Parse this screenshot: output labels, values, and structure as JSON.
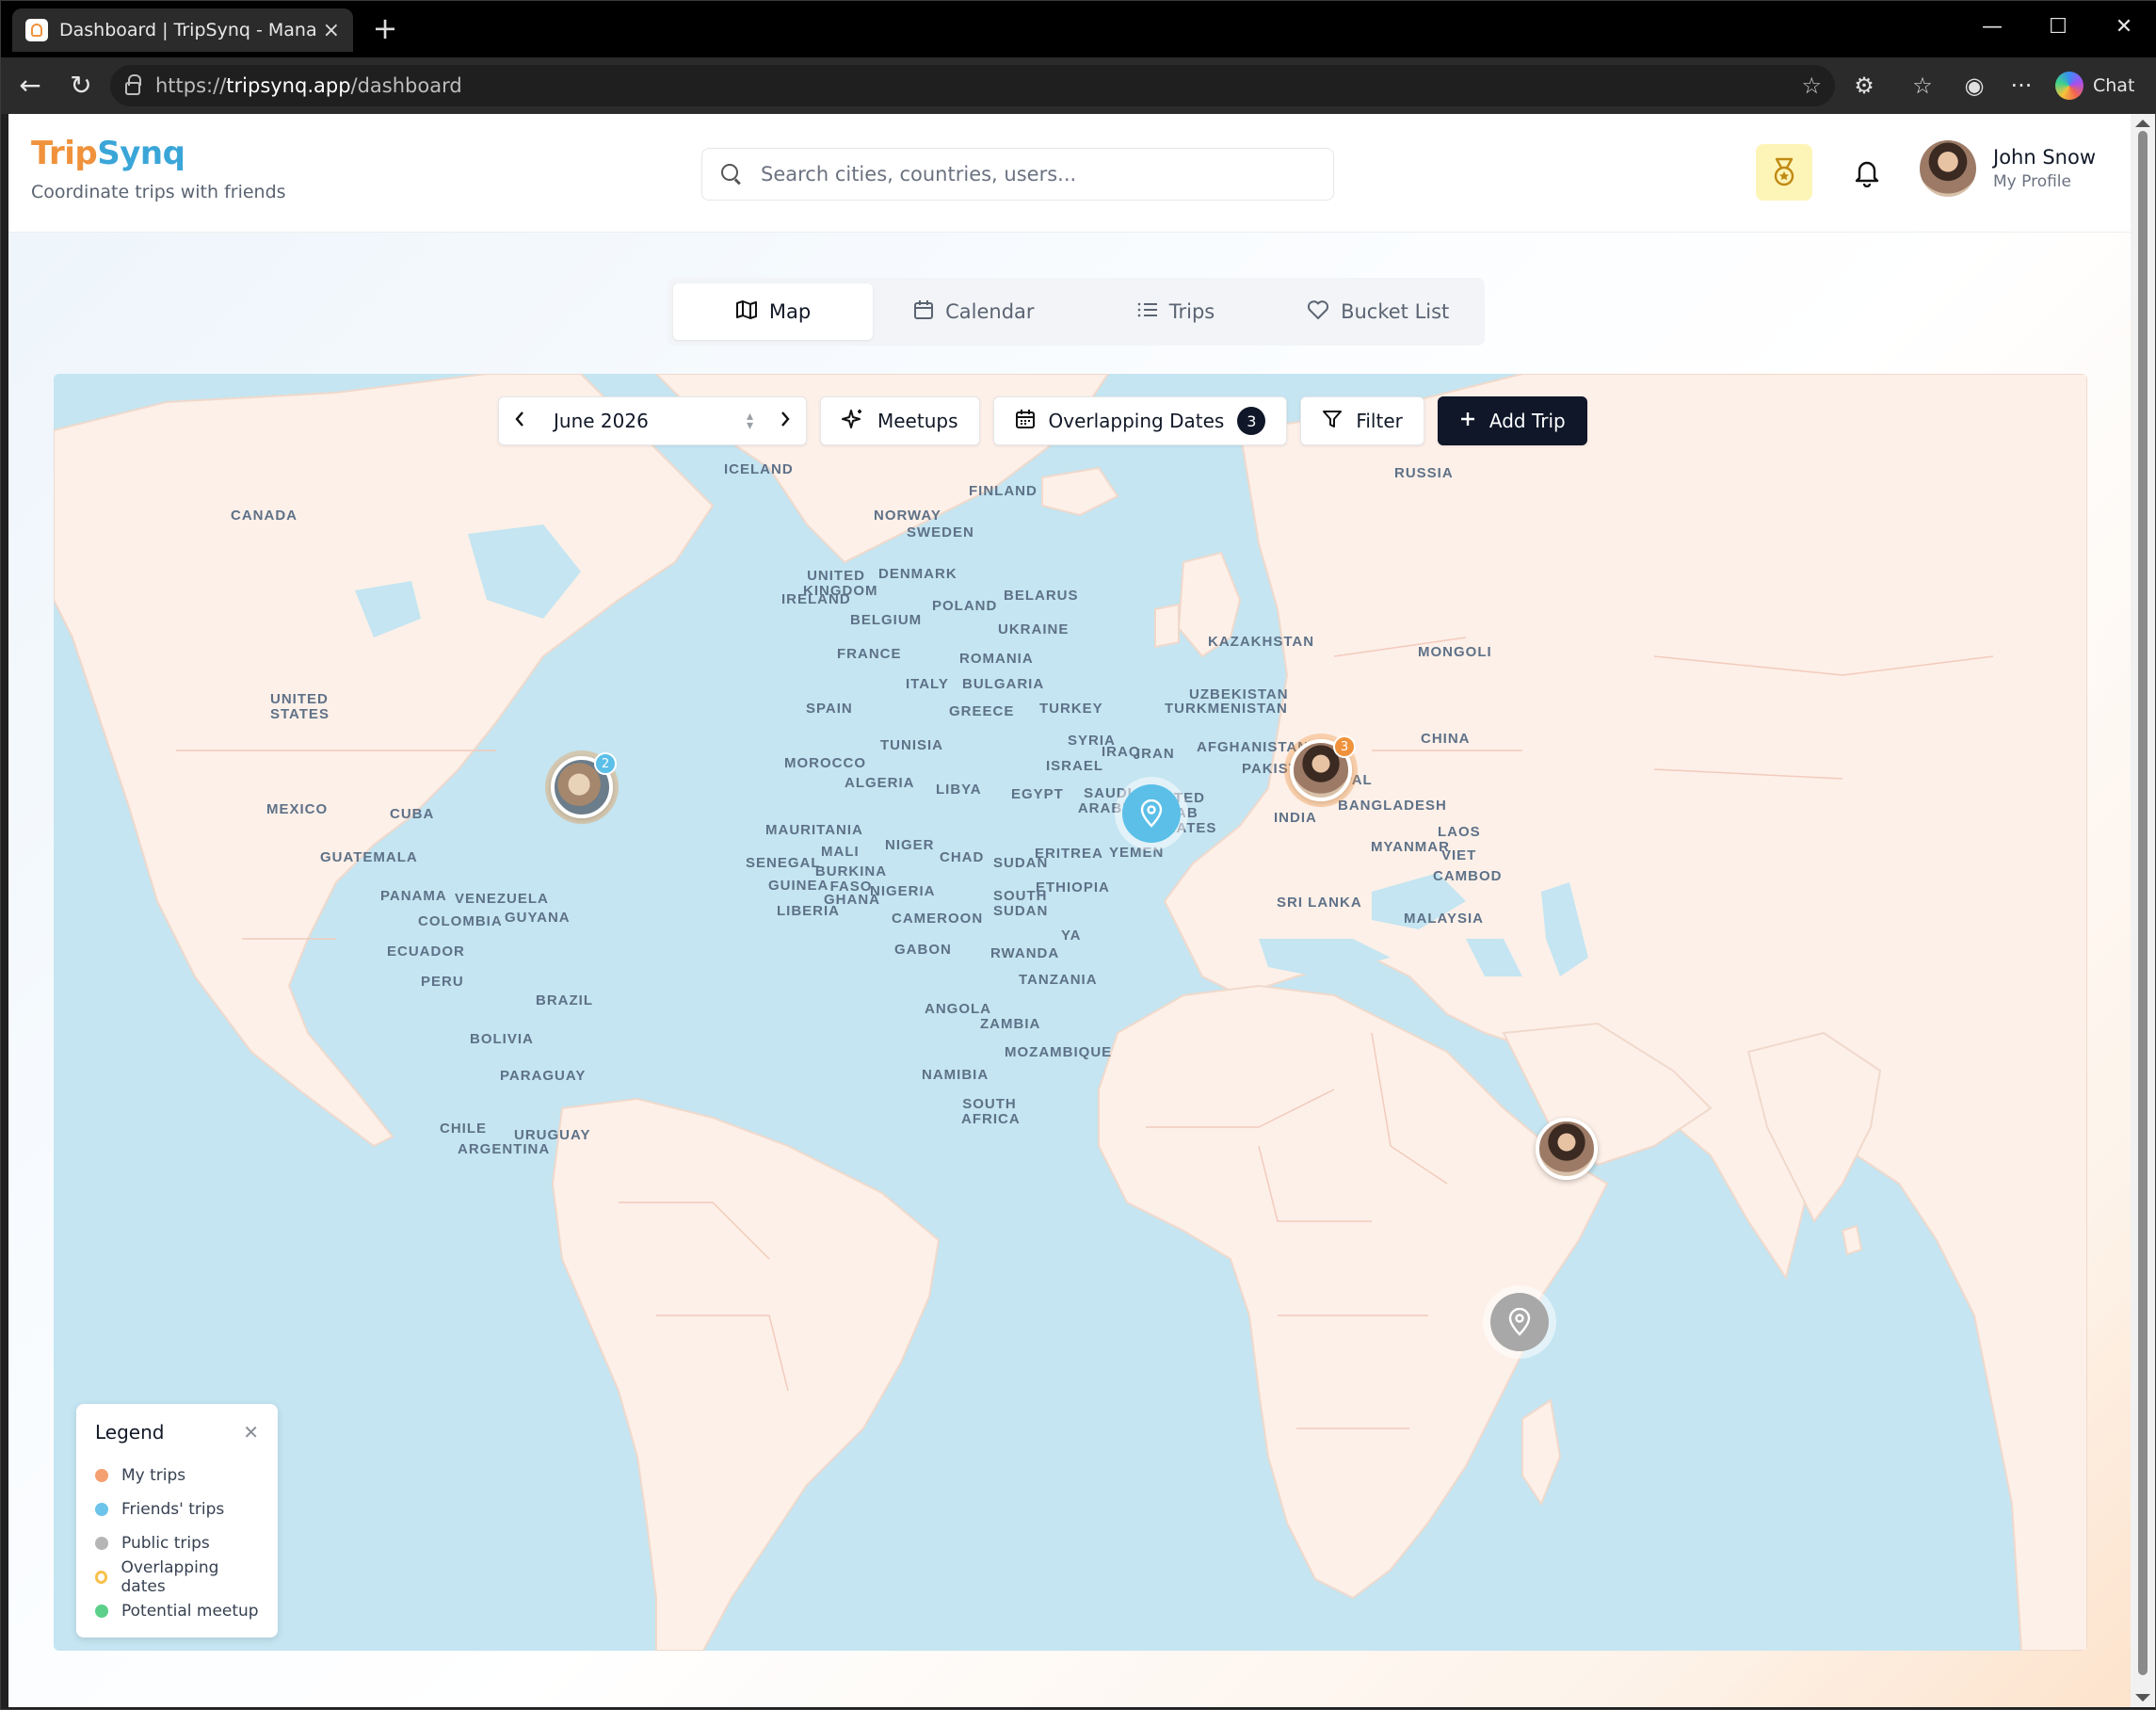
{
  "browser": {
    "tab_title": "Dashboard | TripSynq - Manage Yo",
    "url_scheme": "https://",
    "url_host": "tripsynq.app",
    "url_path": "/dashboard",
    "chat_label": "Chat"
  },
  "header": {
    "brand_part1": "Trip",
    "brand_part2": "Synq",
    "tagline": "Coordinate trips with friends",
    "search_placeholder": "Search cities, countries, users...",
    "user_name": "John Snow",
    "user_sub": "My Profile"
  },
  "tabs": [
    {
      "label": "Map",
      "icon": "map-icon",
      "active": true
    },
    {
      "label": "Calendar",
      "icon": "calendar-icon"
    },
    {
      "label": "Trips",
      "icon": "list-icon"
    },
    {
      "label": "Bucket List",
      "icon": "heart-icon"
    }
  ],
  "toolbar": {
    "month": "June 2026",
    "meetups": "Meetups",
    "overlapping": "Overlapping Dates",
    "overlapping_count": "3",
    "filter": "Filter",
    "add_trip": "Add Trip"
  },
  "countries": [
    "CANADA",
    "UNITED STATES",
    "MEXICO",
    "CUBA",
    "GUATEMALA",
    "PANAMA",
    "VENEZUELA",
    "COLOMBIA",
    "GUYANA",
    "ECUADOR",
    "PERU",
    "BRAZIL",
    "BOLIVIA",
    "PARAGUAY",
    "CHILE",
    "URUGUAY",
    "ARGENTINA",
    "ICELAND",
    "NORWAY",
    "SWEDEN",
    "FINLAND",
    "DENMARK",
    "UNITED KINGDOM",
    "IRELAND",
    "BELGIUM",
    "FRANCE",
    "SPAIN",
    "POLAND",
    "BELARUS",
    "UKRAINE",
    "ROMANIA",
    "BULGARIA",
    "GREECE",
    "ITALY",
    "TURKEY",
    "RUSSIA",
    "KAZAKHSTAN",
    "MONGOLI",
    "UZBEKISTAN",
    "TURKMENISTAN",
    "AFGHANISTAN",
    "PAKISTAN",
    "IRAN",
    "IRAQ",
    "SYRIA",
    "ISRAEL",
    "EGYPT",
    "SAUDI ARABIA",
    "UNITED ARAB EMIRATES",
    "YEMEN",
    "INDIA",
    "NEPAL",
    "BANGLADESH",
    "CHINA",
    "MYANMAR",
    "LAOS",
    "VIET",
    "CAMBOD",
    "SRI LANKA",
    "MALAYSIA",
    "MOROCCO",
    "ALGERIA",
    "TUNISIA",
    "LIBYA",
    "MAURITANIA",
    "MALI",
    "NIGER",
    "CHAD",
    "SUDAN",
    "ERITREA",
    "ETHIOPIA",
    "SOUTH SUDAN",
    "SENEGAL",
    "BURKINA FASO",
    "GUINEA",
    "GHANA",
    "NIGERIA",
    "LIBERIA",
    "CAMEROON",
    "GABON",
    "RWANDA",
    "TANZANIA",
    "ANGOLA",
    "ZAMBIA",
    "MOZAMBIQUE",
    "NAMIBIA",
    "SOUTH AFRICA",
    "YA"
  ],
  "markers": [
    {
      "name": "friend-trip-north-america",
      "type": "photo",
      "count": "2",
      "count_color": "#5bbfe8"
    },
    {
      "name": "my-trip-central-europe",
      "type": "photo",
      "count": "3",
      "count_color": "#f0923c"
    },
    {
      "name": "friend-trip-iberia",
      "type": "pin",
      "color": "#5bbfe8"
    },
    {
      "name": "photo-trip-arabia",
      "type": "photo"
    },
    {
      "name": "public-trip-east-africa",
      "type": "pin",
      "color": "#a8a8a8"
    }
  ],
  "legend": {
    "title": "Legend",
    "items": [
      {
        "label": "My trips",
        "color": "#f5a070"
      },
      {
        "label": "Friends' trips",
        "color": "#6cc4ea"
      },
      {
        "label": "Public trips",
        "color": "#b5b5b5"
      },
      {
        "label": "Overlapping dates",
        "color": "#f7c04a"
      },
      {
        "label": "Potential meetup",
        "color": "#5ccf8a"
      }
    ]
  }
}
